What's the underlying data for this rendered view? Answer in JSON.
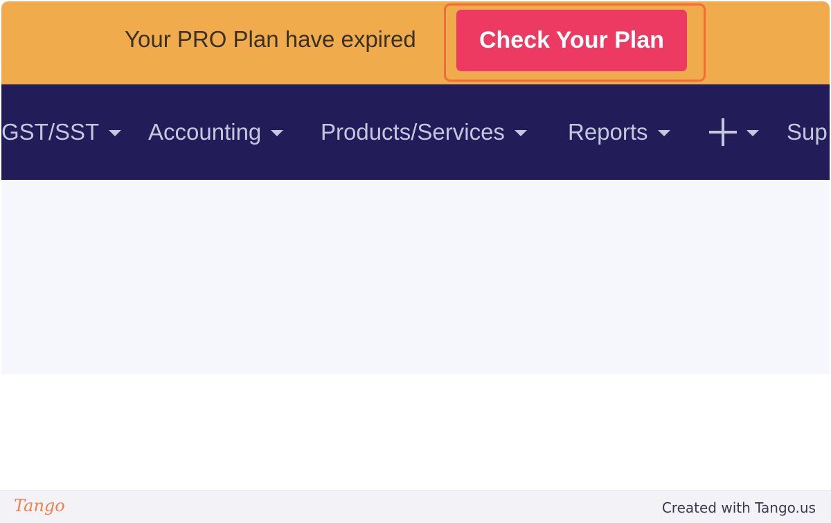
{
  "banner": {
    "message": "Your PRO Plan have expired",
    "cta_label": "Check Your Plan"
  },
  "navbar": {
    "items": [
      {
        "label": "GST/SST"
      },
      {
        "label": "Accounting"
      },
      {
        "label": "Products/Services"
      },
      {
        "label": "Reports"
      },
      {
        "icon": "plus-icon"
      },
      {
        "label": "Sup"
      }
    ]
  },
  "footer": {
    "logo_text": "Tango",
    "credit": "Created with Tango.us"
  },
  "colors": {
    "banner_bg": "#efab4c",
    "cta_bg": "#ec3a62",
    "highlight": "#f36b3a",
    "navbar_bg": "#221c58",
    "nav_text": "#c4c8de"
  }
}
